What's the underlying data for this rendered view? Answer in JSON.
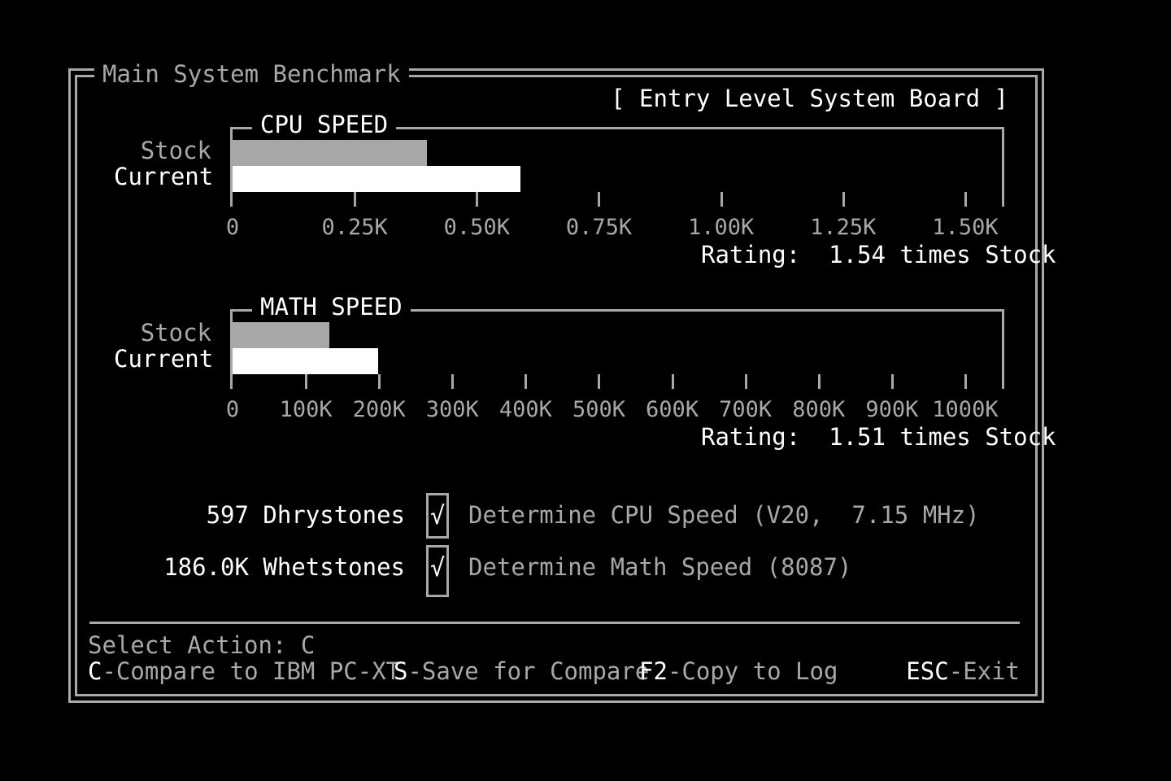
{
  "window": {
    "title": "Main System Benchmark",
    "board_label": "[ Entry Level System Board ]"
  },
  "colors": {
    "background": "#000000",
    "frame": "#a8a8a8",
    "stock_bar": "#a8a8a8",
    "current_bar": "#ffffff",
    "text_bright": "#ffffff",
    "text_dim": "#a8a8a8"
  },
  "chart_data": [
    {
      "type": "bar",
      "title": "CPU SPEED",
      "categories": [
        "Stock",
        "Current"
      ],
      "series": [
        {
          "values": [
            398,
            590
          ]
        }
      ],
      "xlim": [
        0,
        1575
      ],
      "tick_values": [
        0,
        250,
        500,
        750,
        1000,
        1250,
        1500
      ],
      "tick_labels": [
        "0",
        "0.25K",
        "0.50K",
        "0.75K",
        "1.00K",
        "1.25K",
        "1.50K"
      ],
      "rating_label": "Rating:",
      "rating_value": "1.54 times Stock"
    },
    {
      "type": "bar",
      "title": "MATH SPEED",
      "categories": [
        "Stock",
        "Current"
      ],
      "series": [
        {
          "values": [
            132000,
            199000
          ]
        }
      ],
      "xlim": [
        0,
        1050000
      ],
      "tick_values": [
        0,
        100000,
        200000,
        300000,
        400000,
        500000,
        600000,
        700000,
        800000,
        900000,
        1000000
      ],
      "tick_labels": [
        "0",
        "100K",
        "200K",
        "300K",
        "400K",
        "500K",
        "600K",
        "700K",
        "800K",
        "900K",
        "1000K"
      ],
      "rating_label": "Rating:",
      "rating_value": "1.51 times Stock"
    }
  ],
  "tests": [
    {
      "result": "597 Dhrystones",
      "checked": true,
      "check_glyph": "√",
      "label": "Determine CPU Speed (V20,  7.15 MHz)"
    },
    {
      "result": "186.0K Whetstones",
      "checked": true,
      "check_glyph": "√",
      "label": "Determine Math Speed (8087)"
    }
  ],
  "footer": {
    "prompt": "Select Action: C",
    "actions": [
      {
        "key": "C",
        "label": "-Compare to IBM PC-XT"
      },
      {
        "key": "S",
        "label": "-Save for Compare"
      },
      {
        "key": "F2",
        "label": "-Copy to Log"
      },
      {
        "key": "ESC",
        "label": "-Exit"
      }
    ]
  }
}
